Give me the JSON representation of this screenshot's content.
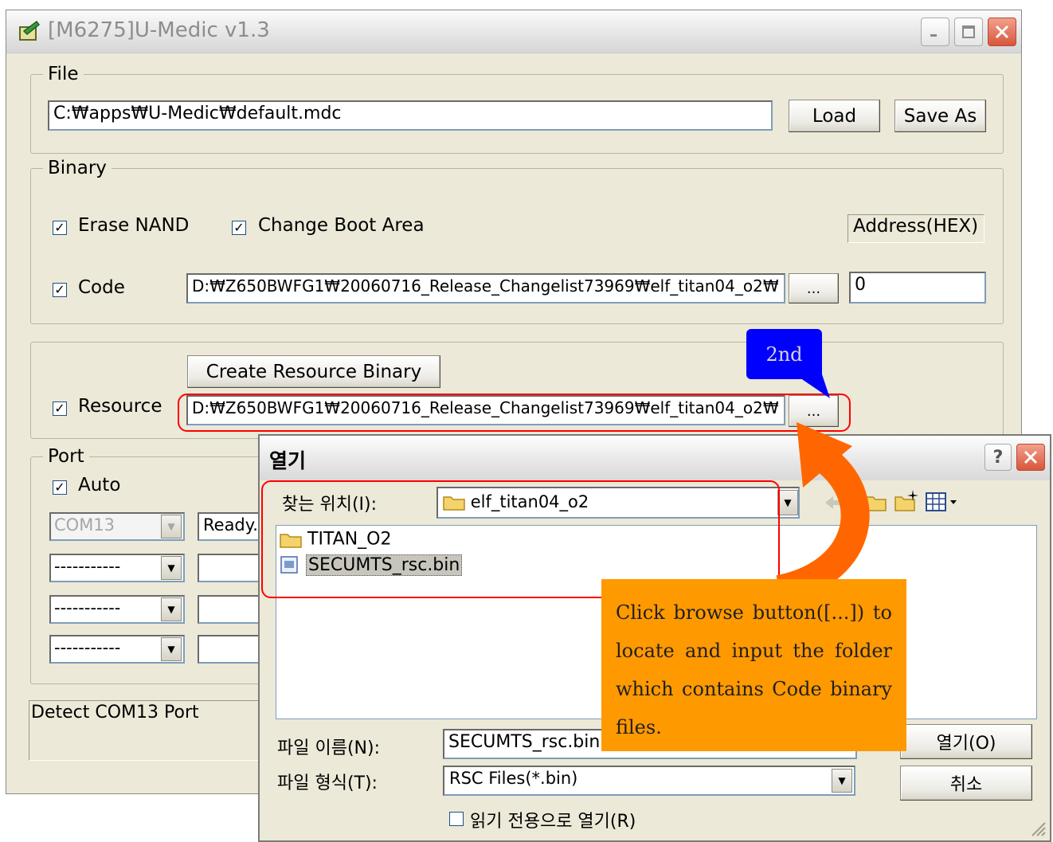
{
  "window": {
    "title": "[M6275]U-Medic v1.3"
  },
  "file_group": {
    "legend": "File",
    "path": "C:₩apps₩U-Medic₩default.mdc",
    "load_label": "Load",
    "save_as_label": "Save As"
  },
  "binary_group": {
    "legend": "Binary",
    "erase_nand_label": "Erase NAND",
    "change_boot_label": "Change Boot Area",
    "address_header": "Address(HEX)",
    "code_label": "Code",
    "code_path": "D:₩Z650BWFG1₩20060716_Release_Changelist73969₩elf_titan04_o2₩",
    "browse_label": "...",
    "code_address": "0"
  },
  "resource_group": {
    "create_button": "Create Resource Binary",
    "resource_label": "Resource",
    "resource_path": "D:₩Z650BWFG1₩20060716_Release_Changelist73969₩elf_titan04_o2₩",
    "browse_label": "..."
  },
  "port_group": {
    "legend": "Port",
    "auto_label": "Auto",
    "com_value": "COM13",
    "status_value": "Ready.",
    "empty_combo": "-----------"
  },
  "status_bar": {
    "text": "Detect COM13 Port"
  },
  "open_dialog": {
    "title": "열기",
    "help_label": "?",
    "look_in_label": "찾는 위치(I):",
    "look_in_value": "elf_titan04_o2",
    "items": [
      {
        "name": "TITAN_O2",
        "icon": "folder-icon"
      },
      {
        "name": "SECUMTS_rsc.bin",
        "icon": "file-icon"
      }
    ],
    "filename_label": "파일 이름(N):",
    "filename_value": "SECUMTS_rsc.bin",
    "filetype_label": "파일 형식(T):",
    "filetype_value": "RSC Files(*.bin)",
    "readonly_label": "읽기 전용으로 열기(R)",
    "open_button": "열기(O)",
    "cancel_button": "취소"
  },
  "annotations": {
    "step_label": "2nd",
    "note": "Click browse button([...]) to locate and input the folder which contains Code binary files."
  },
  "colors": {
    "callout_blue": "#0000ff",
    "note_orange": "#ff9900",
    "arrow_orange": "#ff6600",
    "highlight_red": "#ff0000"
  }
}
